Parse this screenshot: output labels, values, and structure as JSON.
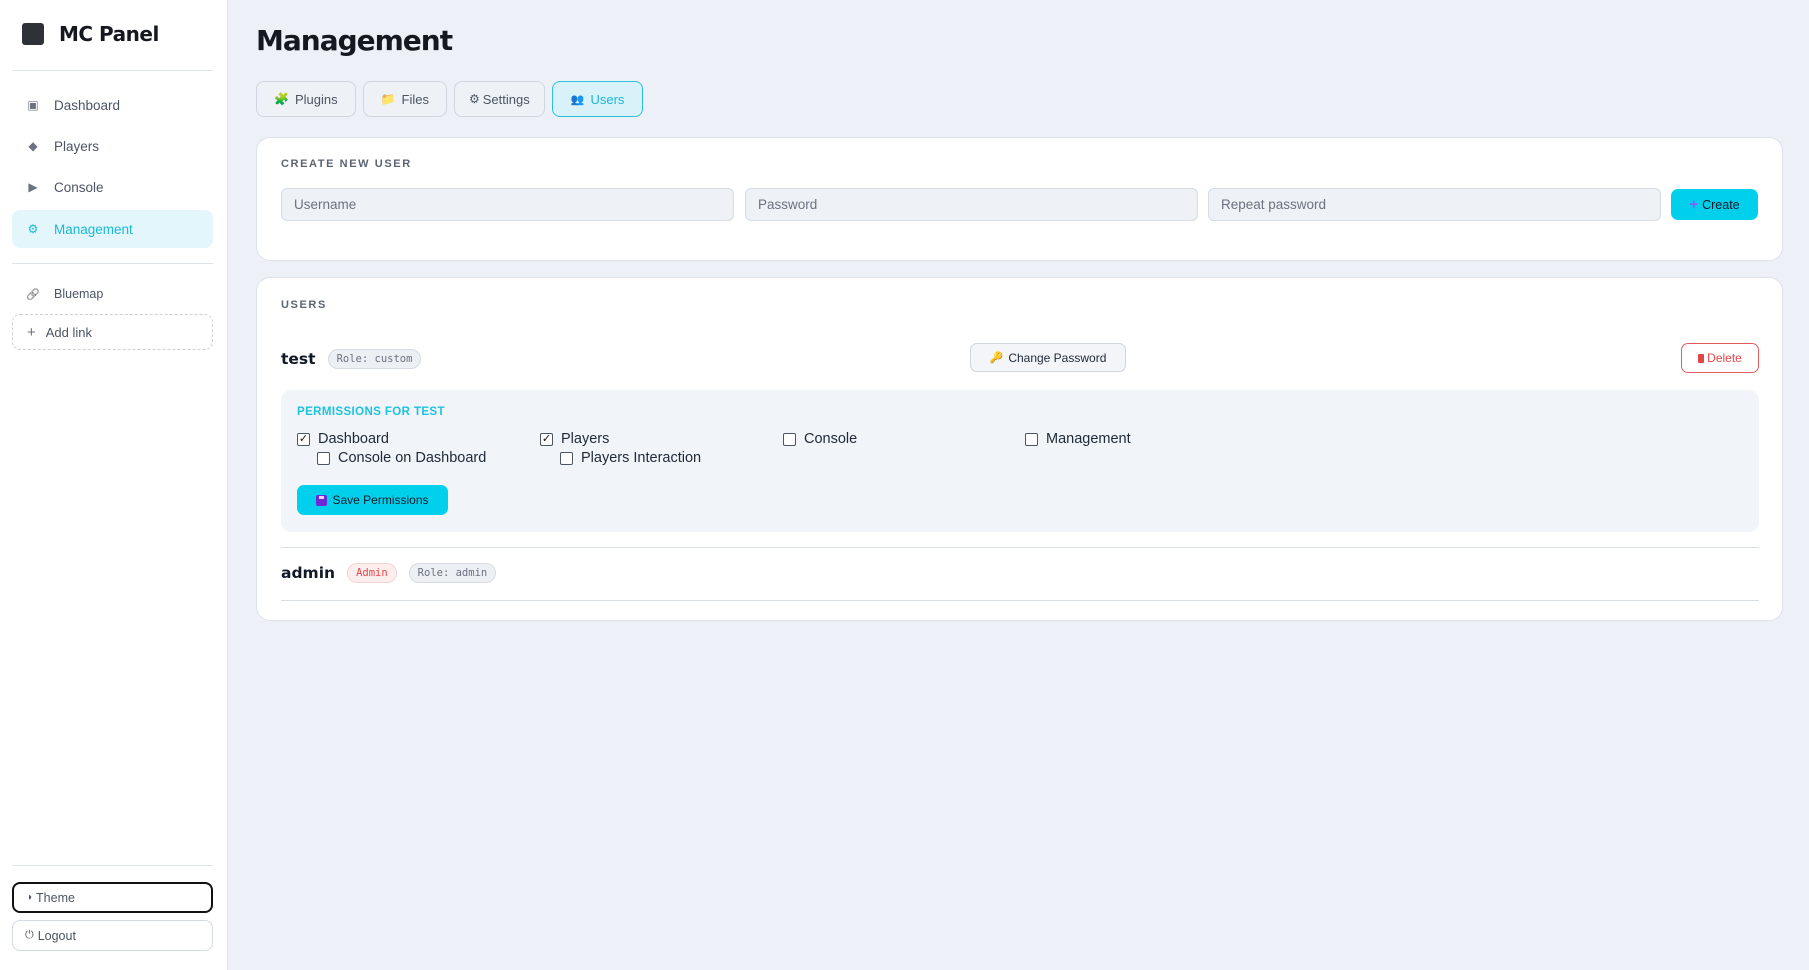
{
  "app": {
    "name": "MC Panel"
  },
  "sidebar": {
    "items": [
      {
        "label": "Dashboard",
        "icon": "dashboard-icon",
        "glyph": "▣"
      },
      {
        "label": "Players",
        "icon": "diamond-icon",
        "glyph": "◆"
      },
      {
        "label": "Console",
        "icon": "play-icon",
        "glyph": "▶"
      },
      {
        "label": "Management",
        "icon": "gear-icon",
        "glyph": "⚙",
        "active": true
      }
    ],
    "links": [
      {
        "label": "Bluemap",
        "icon": "link-icon",
        "glyph": "🔗"
      }
    ],
    "add_link": "Add link",
    "theme": "Theme",
    "logout": "Logout"
  },
  "main": {
    "title": "Management",
    "tabs": [
      {
        "label": "Plugins",
        "glyph": "🧩"
      },
      {
        "label": "Files",
        "glyph": "📁"
      },
      {
        "label": "Settings",
        "glyph": "⚙"
      },
      {
        "label": "Users",
        "glyph": "👥",
        "active": true
      }
    ]
  },
  "create_user": {
    "heading": "CREATE NEW USER",
    "username_placeholder": "Username",
    "password_placeholder": "Password",
    "repeat_placeholder": "Repeat password",
    "create_label": "Create"
  },
  "users": {
    "heading": "USERS",
    "list": [
      {
        "name": "test",
        "role": "Role: custom",
        "change_password": "Change Password",
        "delete": "Delete",
        "permissions_title": "PERMISSIONS FOR TEST",
        "permissions": [
          {
            "label": "Dashboard",
            "checked": true
          },
          {
            "label": "Console on Dashboard",
            "checked": false
          },
          {
            "label": "Players",
            "checked": true
          },
          {
            "label": "Players Interaction",
            "checked": false
          },
          {
            "label": "Console",
            "checked": false
          },
          {
            "label": "Management",
            "checked": false
          }
        ],
        "save": "Save Permissions"
      },
      {
        "name": "admin",
        "badge": "Admin",
        "role": "Role: admin"
      }
    ]
  },
  "colors": {
    "accent": "#00d0ec",
    "danger": "#e04848",
    "background": "#edf1f7"
  }
}
